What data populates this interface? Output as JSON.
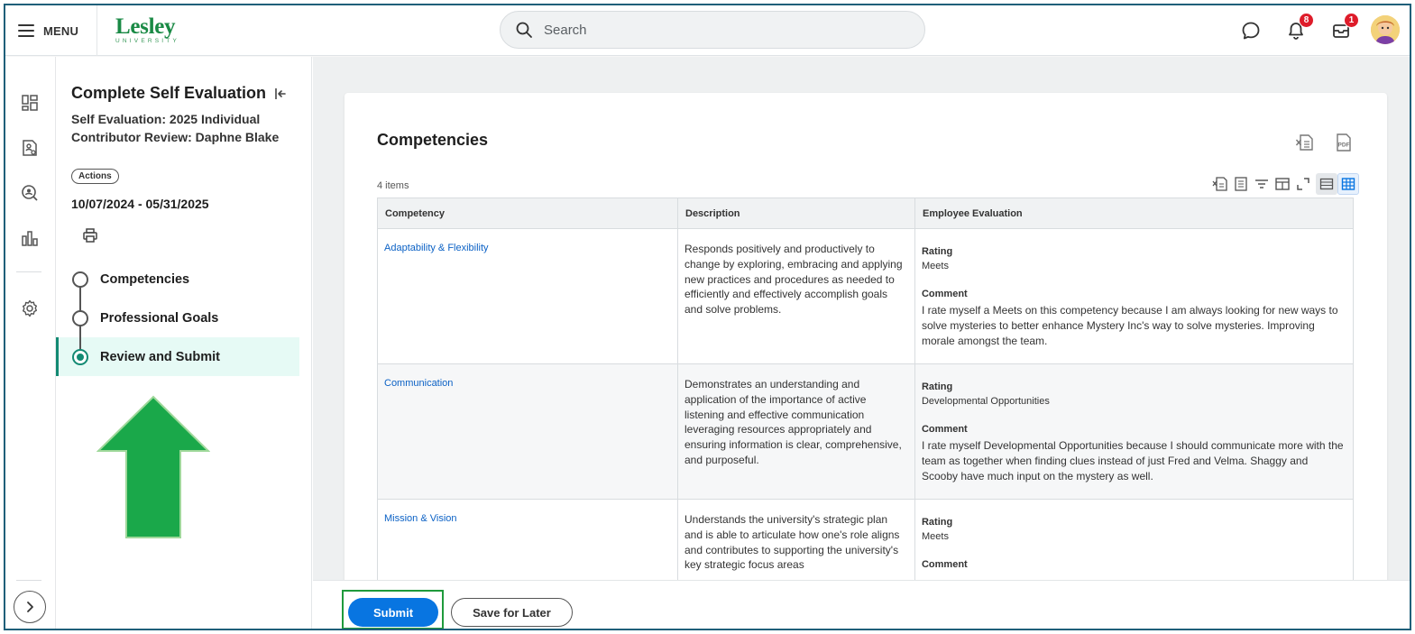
{
  "header": {
    "menu_label": "MENU",
    "logo_name": "Lesley",
    "logo_sub": "UNIVERSITY",
    "search_placeholder": "Search",
    "notifications_count": "8",
    "inbox_count": "1",
    "icons": [
      "menu-icon",
      "search-icon",
      "chat-icon",
      "bell-icon",
      "inbox-icon"
    ],
    "badge_color": "#de1c2a"
  },
  "rail": {
    "icons": [
      "dashboard-icon",
      "profile-document-icon",
      "search-person-icon",
      "bar-chart-icon",
      "gear-icon",
      "chevron-right-icon"
    ]
  },
  "panel": {
    "title": "Complete Self Evaluation",
    "subtitle": "Self Evaluation: 2025 Individual Contributor Review: Daphne Blake",
    "actions_label": "Actions",
    "date_range": "10/07/2024 - 05/31/2025",
    "steps": [
      {
        "label": "Competencies",
        "active": false
      },
      {
        "label": "Professional Goals",
        "active": false
      },
      {
        "label": "Review and Submit",
        "active": true
      }
    ],
    "accent_color": "#138a73"
  },
  "main": {
    "section_title": "Competencies",
    "export_icons": [
      "excel-export-icon",
      "pdf-export-icon"
    ],
    "items_count": "4 items",
    "columns": [
      "Competency",
      "Description",
      "Employee Evaluation"
    ],
    "rating_label": "Rating",
    "comment_label": "Comment",
    "rows": [
      {
        "competency": "Adaptability & Flexibility",
        "description": "Responds positively and productively to change by exploring, embracing and applying new practices and procedures as needed to efficiently and effectively accomplish goals and solve problems.",
        "rating": "Meets",
        "comment": "I rate myself a Meets on this competency because I am always looking for new ways to solve mysteries to better enhance Mystery Inc's way to solve mysteries. Improving morale amongst the team."
      },
      {
        "competency": "Communication",
        "description": "Demonstrates an understanding and application of the importance of active listening and effective communication leveraging resources appropriately and ensuring information is clear, comprehensive, and purposeful.",
        "rating": "Developmental Opportunities",
        "comment": "I rate myself Developmental Opportunities because I should communicate more with the team as together when finding clues instead of just Fred and Velma. Shaggy and Scooby have much input on the mystery as well."
      },
      {
        "competency": "Mission & Vision",
        "description": "Understands the university's strategic plan and is able to articulate how one's role aligns and contributes to supporting the university's key strategic focus areas",
        "rating": "Meets",
        "comment": ""
      }
    ],
    "link_color": "#0b61c5"
  },
  "footer": {
    "submit_label": "Submit",
    "save_later_label": "Save for Later",
    "submit_color": "#0875e1",
    "highlight_color": "#1f9a3c"
  }
}
